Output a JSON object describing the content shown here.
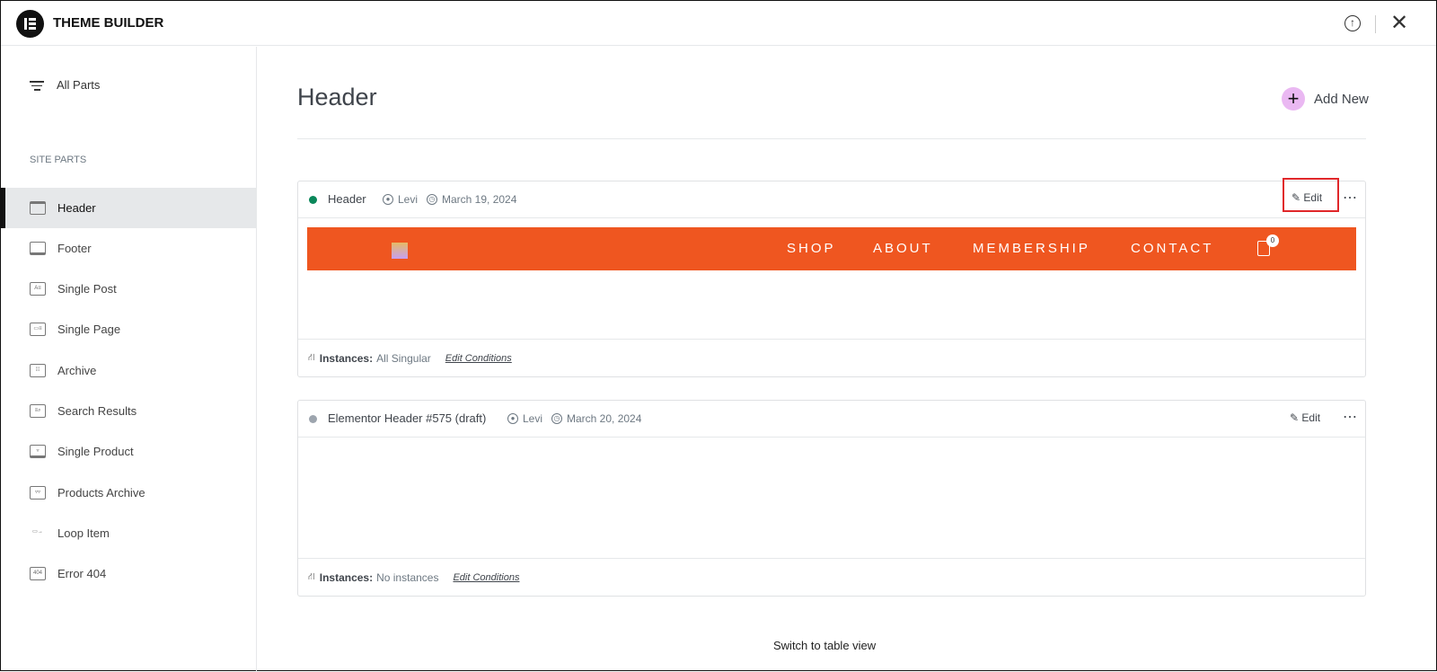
{
  "app": {
    "title": "THEME BUILDER"
  },
  "sidebar": {
    "all_parts": "All Parts",
    "section_label": "SITE PARTS",
    "items": [
      {
        "label": "Header",
        "icon": "header-icon"
      },
      {
        "label": "Footer",
        "icon": "footer-icon"
      },
      {
        "label": "Single Post",
        "icon": "single-post-icon"
      },
      {
        "label": "Single Page",
        "icon": "single-page-icon"
      },
      {
        "label": "Archive",
        "icon": "archive-icon"
      },
      {
        "label": "Search Results",
        "icon": "search-results-icon"
      },
      {
        "label": "Single Product",
        "icon": "single-product-icon"
      },
      {
        "label": "Products Archive",
        "icon": "products-archive-icon"
      },
      {
        "label": "Loop Item",
        "icon": "loop-item-icon"
      },
      {
        "label": "Error 404",
        "icon": "error-404-icon",
        "icon_text": "404"
      }
    ]
  },
  "main": {
    "title": "Header",
    "add_new": "Add New",
    "switch_view": "Switch to table view",
    "cards": [
      {
        "title": "Header",
        "status_color": "#0a875a",
        "author": "Levi",
        "date": "March 19, 2024",
        "edit": "Edit",
        "instances_label": "Instances:",
        "instances": "All Singular",
        "edit_conditions": "Edit Conditions",
        "preview": {
          "menu": [
            "SHOP",
            "ABOUT",
            "MEMBERSHIP",
            "CONTACT"
          ],
          "cart_count": "0",
          "bg": "#ef5620"
        }
      },
      {
        "title": "Elementor Header #575 (draft)",
        "status_color": "#9da5ae",
        "author": "Levi",
        "date": "March 20, 2024",
        "edit": "Edit",
        "instances_label": "Instances:",
        "instances": "No instances",
        "edit_conditions": "Edit Conditions"
      }
    ]
  }
}
